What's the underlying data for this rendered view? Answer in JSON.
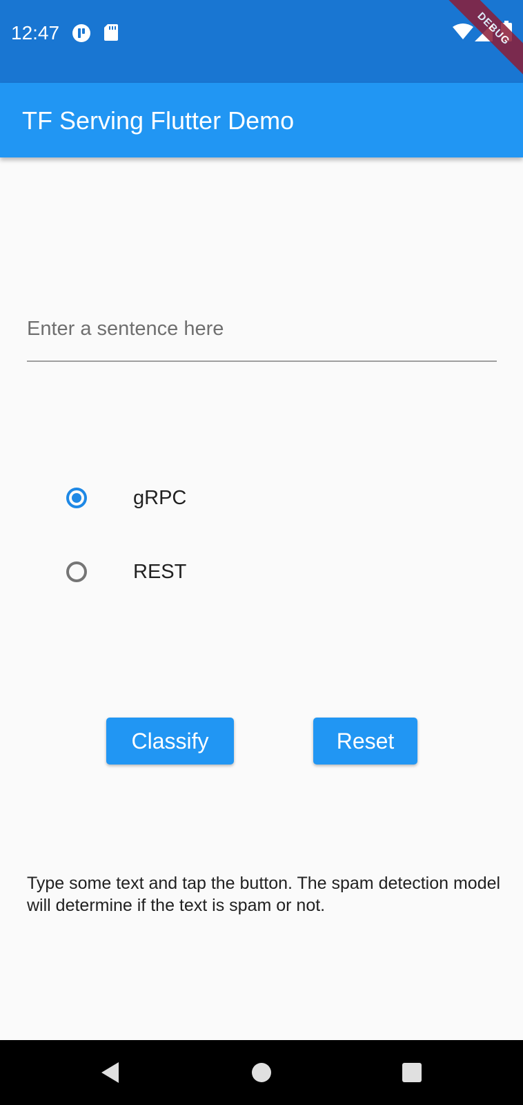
{
  "status_bar": {
    "time": "12:47",
    "icons": [
      "notification-icon",
      "sd-card-icon",
      "wifi-icon",
      "signal-icon",
      "battery-icon"
    ],
    "color": "#1976d2"
  },
  "debug_banner": {
    "label": "DEBUG",
    "color": "#8b1d37"
  },
  "app_bar": {
    "title": "TF Serving Flutter Demo",
    "color": "#2196f3"
  },
  "input": {
    "value": "",
    "placeholder": "Enter a sentence here"
  },
  "connection_options": [
    {
      "label": "gRPC",
      "selected": true
    },
    {
      "label": "REST",
      "selected": false
    }
  ],
  "buttons": {
    "classify_label": "Classify",
    "reset_label": "Reset"
  },
  "description": "Type some text and tap the button. The spam detection model will determine if the text is spam or not.",
  "nav_bar": {
    "icons": [
      "back-icon",
      "home-icon",
      "recents-icon"
    ]
  },
  "colors": {
    "accent": "#1e88e5",
    "background": "#fafafa",
    "text": "#212121"
  }
}
